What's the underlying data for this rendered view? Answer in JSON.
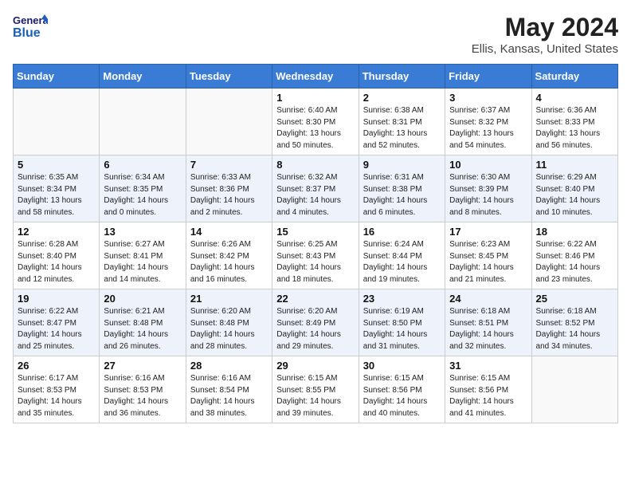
{
  "header": {
    "logo_general": "General",
    "logo_blue": "Blue",
    "month_title": "May 2024",
    "location": "Ellis, Kansas, United States"
  },
  "days_of_week": [
    "Sunday",
    "Monday",
    "Tuesday",
    "Wednesday",
    "Thursday",
    "Friday",
    "Saturday"
  ],
  "weeks": [
    [
      {
        "day": "",
        "sunrise": "",
        "sunset": "",
        "daylight": ""
      },
      {
        "day": "",
        "sunrise": "",
        "sunset": "",
        "daylight": ""
      },
      {
        "day": "",
        "sunrise": "",
        "sunset": "",
        "daylight": ""
      },
      {
        "day": "1",
        "sunrise": "Sunrise: 6:40 AM",
        "sunset": "Sunset: 8:30 PM",
        "daylight": "Daylight: 13 hours and 50 minutes."
      },
      {
        "day": "2",
        "sunrise": "Sunrise: 6:38 AM",
        "sunset": "Sunset: 8:31 PM",
        "daylight": "Daylight: 13 hours and 52 minutes."
      },
      {
        "day": "3",
        "sunrise": "Sunrise: 6:37 AM",
        "sunset": "Sunset: 8:32 PM",
        "daylight": "Daylight: 13 hours and 54 minutes."
      },
      {
        "day": "4",
        "sunrise": "Sunrise: 6:36 AM",
        "sunset": "Sunset: 8:33 PM",
        "daylight": "Daylight: 13 hours and 56 minutes."
      }
    ],
    [
      {
        "day": "5",
        "sunrise": "Sunrise: 6:35 AM",
        "sunset": "Sunset: 8:34 PM",
        "daylight": "Daylight: 13 hours and 58 minutes."
      },
      {
        "day": "6",
        "sunrise": "Sunrise: 6:34 AM",
        "sunset": "Sunset: 8:35 PM",
        "daylight": "Daylight: 14 hours and 0 minutes."
      },
      {
        "day": "7",
        "sunrise": "Sunrise: 6:33 AM",
        "sunset": "Sunset: 8:36 PM",
        "daylight": "Daylight: 14 hours and 2 minutes."
      },
      {
        "day": "8",
        "sunrise": "Sunrise: 6:32 AM",
        "sunset": "Sunset: 8:37 PM",
        "daylight": "Daylight: 14 hours and 4 minutes."
      },
      {
        "day": "9",
        "sunrise": "Sunrise: 6:31 AM",
        "sunset": "Sunset: 8:38 PM",
        "daylight": "Daylight: 14 hours and 6 minutes."
      },
      {
        "day": "10",
        "sunrise": "Sunrise: 6:30 AM",
        "sunset": "Sunset: 8:39 PM",
        "daylight": "Daylight: 14 hours and 8 minutes."
      },
      {
        "day": "11",
        "sunrise": "Sunrise: 6:29 AM",
        "sunset": "Sunset: 8:40 PM",
        "daylight": "Daylight: 14 hours and 10 minutes."
      }
    ],
    [
      {
        "day": "12",
        "sunrise": "Sunrise: 6:28 AM",
        "sunset": "Sunset: 8:40 PM",
        "daylight": "Daylight: 14 hours and 12 minutes."
      },
      {
        "day": "13",
        "sunrise": "Sunrise: 6:27 AM",
        "sunset": "Sunset: 8:41 PM",
        "daylight": "Daylight: 14 hours and 14 minutes."
      },
      {
        "day": "14",
        "sunrise": "Sunrise: 6:26 AM",
        "sunset": "Sunset: 8:42 PM",
        "daylight": "Daylight: 14 hours and 16 minutes."
      },
      {
        "day": "15",
        "sunrise": "Sunrise: 6:25 AM",
        "sunset": "Sunset: 8:43 PM",
        "daylight": "Daylight: 14 hours and 18 minutes."
      },
      {
        "day": "16",
        "sunrise": "Sunrise: 6:24 AM",
        "sunset": "Sunset: 8:44 PM",
        "daylight": "Daylight: 14 hours and 19 minutes."
      },
      {
        "day": "17",
        "sunrise": "Sunrise: 6:23 AM",
        "sunset": "Sunset: 8:45 PM",
        "daylight": "Daylight: 14 hours and 21 minutes."
      },
      {
        "day": "18",
        "sunrise": "Sunrise: 6:22 AM",
        "sunset": "Sunset: 8:46 PM",
        "daylight": "Daylight: 14 hours and 23 minutes."
      }
    ],
    [
      {
        "day": "19",
        "sunrise": "Sunrise: 6:22 AM",
        "sunset": "Sunset: 8:47 PM",
        "daylight": "Daylight: 14 hours and 25 minutes."
      },
      {
        "day": "20",
        "sunrise": "Sunrise: 6:21 AM",
        "sunset": "Sunset: 8:48 PM",
        "daylight": "Daylight: 14 hours and 26 minutes."
      },
      {
        "day": "21",
        "sunrise": "Sunrise: 6:20 AM",
        "sunset": "Sunset: 8:48 PM",
        "daylight": "Daylight: 14 hours and 28 minutes."
      },
      {
        "day": "22",
        "sunrise": "Sunrise: 6:20 AM",
        "sunset": "Sunset: 8:49 PM",
        "daylight": "Daylight: 14 hours and 29 minutes."
      },
      {
        "day": "23",
        "sunrise": "Sunrise: 6:19 AM",
        "sunset": "Sunset: 8:50 PM",
        "daylight": "Daylight: 14 hours and 31 minutes."
      },
      {
        "day": "24",
        "sunrise": "Sunrise: 6:18 AM",
        "sunset": "Sunset: 8:51 PM",
        "daylight": "Daylight: 14 hours and 32 minutes."
      },
      {
        "day": "25",
        "sunrise": "Sunrise: 6:18 AM",
        "sunset": "Sunset: 8:52 PM",
        "daylight": "Daylight: 14 hours and 34 minutes."
      }
    ],
    [
      {
        "day": "26",
        "sunrise": "Sunrise: 6:17 AM",
        "sunset": "Sunset: 8:53 PM",
        "daylight": "Daylight: 14 hours and 35 minutes."
      },
      {
        "day": "27",
        "sunrise": "Sunrise: 6:16 AM",
        "sunset": "Sunset: 8:53 PM",
        "daylight": "Daylight: 14 hours and 36 minutes."
      },
      {
        "day": "28",
        "sunrise": "Sunrise: 6:16 AM",
        "sunset": "Sunset: 8:54 PM",
        "daylight": "Daylight: 14 hours and 38 minutes."
      },
      {
        "day": "29",
        "sunrise": "Sunrise: 6:15 AM",
        "sunset": "Sunset: 8:55 PM",
        "daylight": "Daylight: 14 hours and 39 minutes."
      },
      {
        "day": "30",
        "sunrise": "Sunrise: 6:15 AM",
        "sunset": "Sunset: 8:56 PM",
        "daylight": "Daylight: 14 hours and 40 minutes."
      },
      {
        "day": "31",
        "sunrise": "Sunrise: 6:15 AM",
        "sunset": "Sunset: 8:56 PM",
        "daylight": "Daylight: 14 hours and 41 minutes."
      },
      {
        "day": "",
        "sunrise": "",
        "sunset": "",
        "daylight": ""
      }
    ]
  ]
}
